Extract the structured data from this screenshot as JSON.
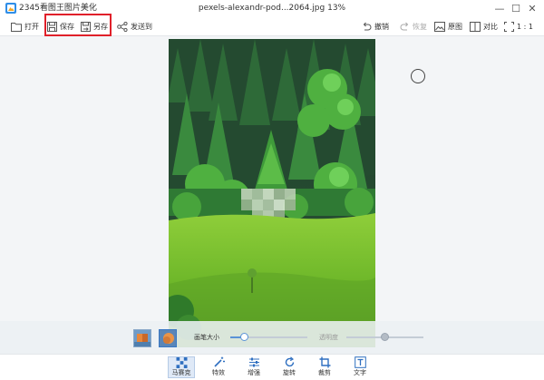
{
  "window": {
    "app_title": "2345看图王图片美化",
    "file_title": "pexels-alexandr-pod...2064.jpg  13%",
    "minimize_glyph": "—",
    "maximize_glyph": "☐",
    "close_glyph": "✕"
  },
  "toolbar": {
    "open_label": "打开",
    "save_label": "保存",
    "save_as_label": "另存",
    "send_label": "发送到",
    "undo_label": "撤销",
    "redo_label": "恢复",
    "original_label": "原图",
    "compare_label": "对比",
    "actual_size_label": "1 : 1"
  },
  "panel": {
    "brush_size_label": "画笔大小",
    "brush_size_value": 0.18,
    "opacity_label": "透明度",
    "opacity_value": 0.49
  },
  "bottom_tools": [
    {
      "label": "马赛克",
      "icon": "mosaic-icon",
      "active": true
    },
    {
      "label": "特效",
      "icon": "magic-wand-icon",
      "active": false
    },
    {
      "label": "增强",
      "icon": "sliders-icon",
      "active": false
    },
    {
      "label": "旋转",
      "icon": "rotate-icon",
      "active": false
    },
    {
      "label": "裁剪",
      "icon": "crop-icon",
      "active": false
    },
    {
      "label": "文字",
      "icon": "text-icon",
      "active": false
    }
  ],
  "colors": {
    "accent": "#5a93d6",
    "highlight_border": "#e0202a",
    "background": "#f3f5f7"
  }
}
